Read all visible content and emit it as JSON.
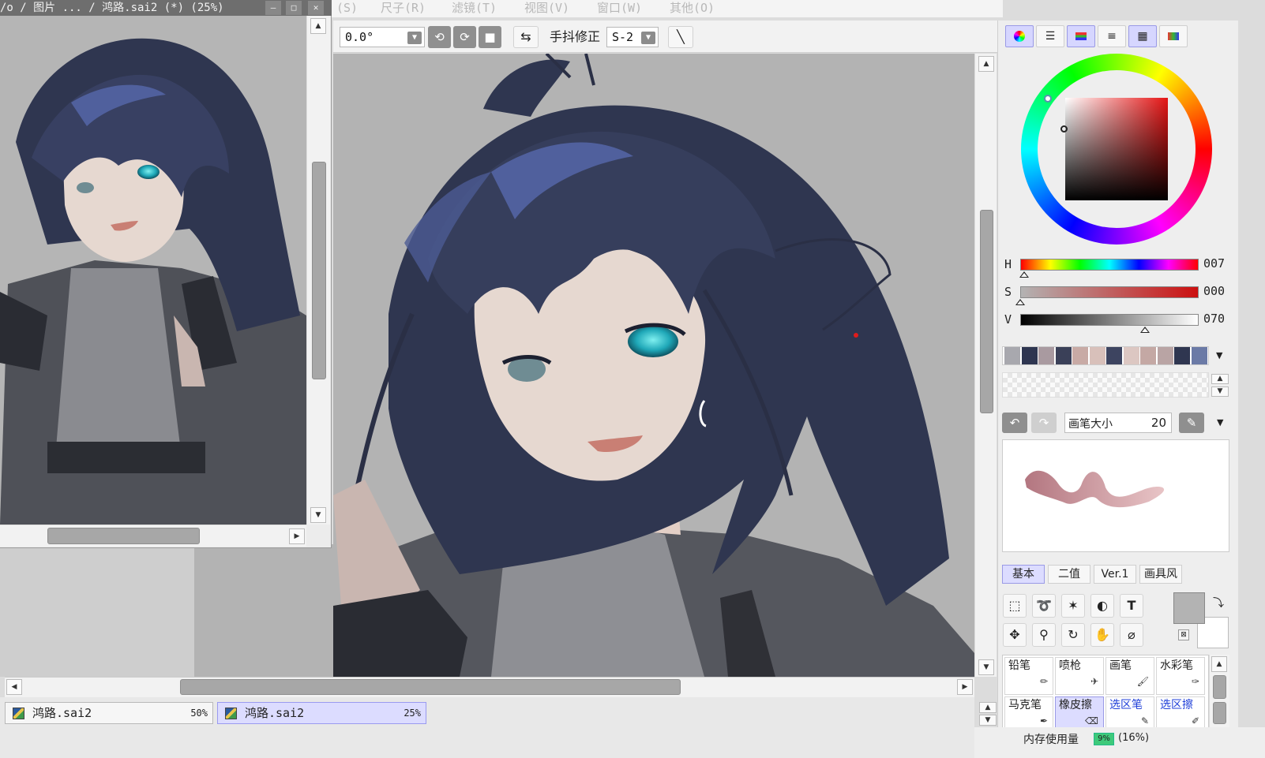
{
  "menubar": {
    "items": [
      "(S)",
      "尺子(R)",
      "滤镜(T)",
      "视图(V)",
      "窗口(W)",
      "其他(O)"
    ]
  },
  "toolbar": {
    "angle_value": "0.0°",
    "stabilizer_label": "手抖修正",
    "stabilizer_value": "S-2"
  },
  "subwindow": {
    "title": "/o / 图片 ... / 鸿路.sai2 (*) (25%)"
  },
  "files": [
    {
      "name": "鸿路.sai2",
      "zoom": "50%",
      "active": false
    },
    {
      "name": "鸿路.sai2",
      "zoom": "25%",
      "active": true
    }
  ],
  "color": {
    "h_label": "H",
    "h_value": "007",
    "h_fraction": 0.02,
    "s_label": "S",
    "s_value": "000",
    "s_fraction": 0.0,
    "v_label": "V",
    "v_value": "070",
    "v_fraction": 0.7,
    "swatches": [
      "#a8a8ae",
      "#2e3550",
      "#a99aa0",
      "#3a4058",
      "#c8aaa5",
      "#d8c0ba",
      "#3d4460",
      "#dcc7c2",
      "#c4a8a4",
      "#b9a4a4",
      "#2f3650",
      "#6b7aa6"
    ]
  },
  "brush": {
    "size_label": "画笔大小",
    "size_value": "20"
  },
  "brush_tabs": [
    "基本",
    "二值",
    "Ver.1",
    "画具风"
  ],
  "brushes": [
    {
      "name": "铅笔",
      "selected": false,
      "blue": false
    },
    {
      "name": "喷枪",
      "selected": false,
      "blue": false
    },
    {
      "name": "画笔",
      "selected": false,
      "blue": false
    },
    {
      "name": "水彩笔",
      "selected": false,
      "blue": false
    },
    {
      "name": "马克笔",
      "selected": false,
      "blue": false
    },
    {
      "name": "橡皮擦",
      "selected": true,
      "blue": false
    },
    {
      "name": "选区笔",
      "selected": false,
      "blue": true
    },
    {
      "name": "选区擦",
      "selected": false,
      "blue": true
    }
  ],
  "status": {
    "memory_label": "内存使用量",
    "memory_bar_label": "9%",
    "memory_value": "(16%)"
  }
}
